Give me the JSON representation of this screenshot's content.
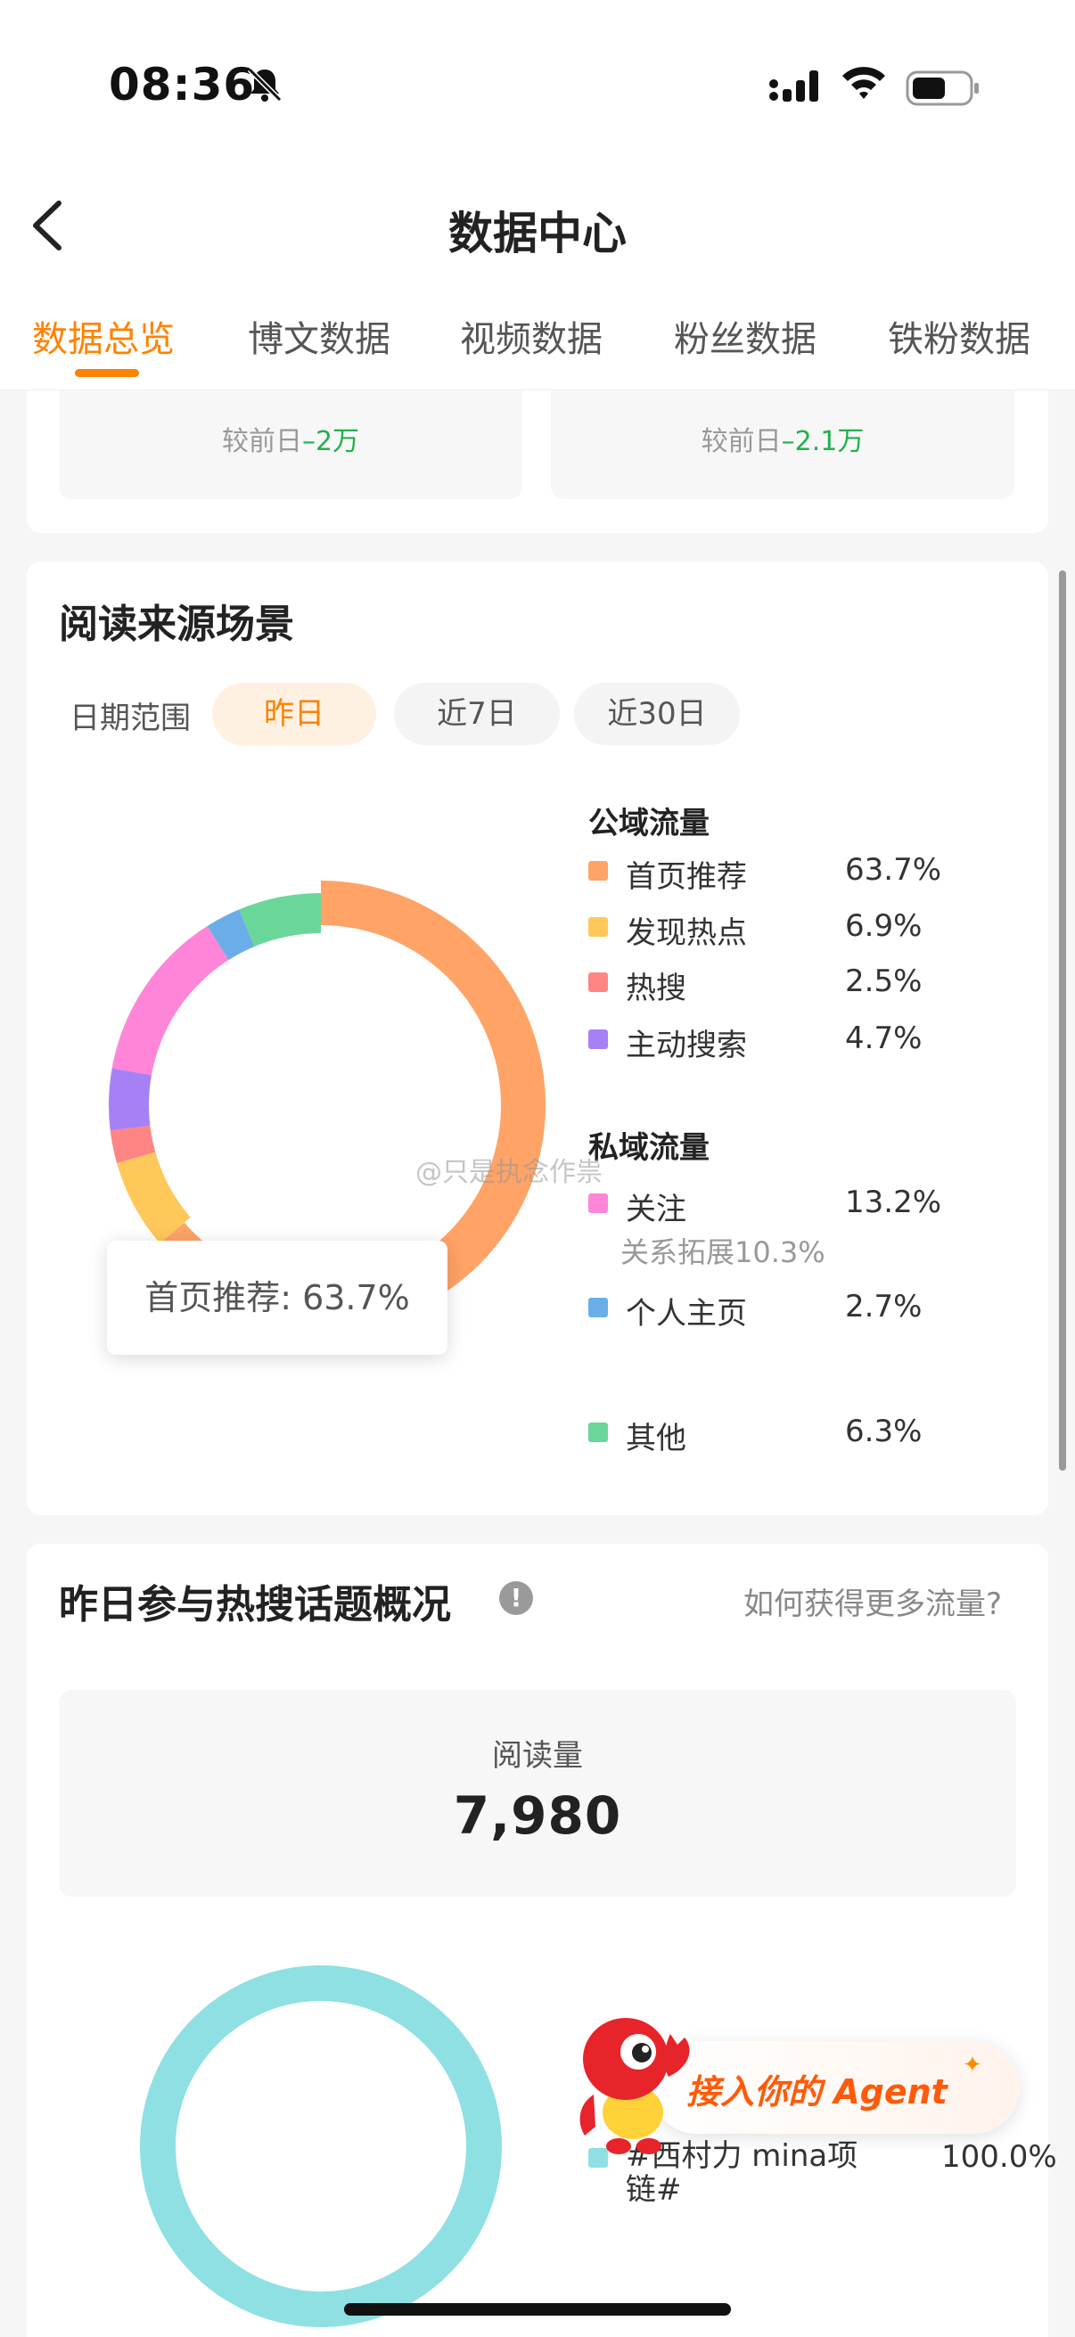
{
  "status": {
    "time": "08:36",
    "icons": [
      "bell-muted-icon",
      "signal-icon",
      "wifi-icon",
      "battery-icon"
    ]
  },
  "nav": {
    "title": "数据中心",
    "back_icon": "chevron-left-icon"
  },
  "tabs": [
    {
      "label": "数据总览",
      "active": true
    },
    {
      "label": "博文数据",
      "active": false
    },
    {
      "label": "视频数据",
      "active": false
    },
    {
      "label": "粉丝数据",
      "active": false
    },
    {
      "label": "铁粉数据",
      "active": false
    }
  ],
  "summary": [
    {
      "prefix": "较前日",
      "change": "–2万"
    },
    {
      "prefix": "较前日",
      "change": "–2.1万"
    }
  ],
  "source": {
    "title": "阅读来源场景",
    "date_label": "日期范围",
    "ranges": [
      {
        "label": "昨日",
        "active": true
      },
      {
        "label": "近7日",
        "active": false
      },
      {
        "label": "近30日",
        "active": false
      }
    ],
    "public_title": "公域流量",
    "private_title": "私域流量",
    "tooltip": "首页推荐: 63.7%",
    "follow_sub": "关系拓展10.3%"
  },
  "chart_data": {
    "type": "pie",
    "donut": true,
    "groups": [
      "公域流量",
      "私域流量"
    ],
    "categories": [
      "首页推荐",
      "发现热点",
      "热搜",
      "主动搜索",
      "关注",
      "个人主页",
      "其他"
    ],
    "labels": [
      "63.7%",
      "6.9%",
      "2.5%",
      "4.7%",
      "13.2%",
      "2.7%",
      "6.3%"
    ],
    "values": [
      63.7,
      6.9,
      2.5,
      4.7,
      13.2,
      2.7,
      6.3
    ],
    "colors": [
      "#ffa366",
      "#ffc85a",
      "#ff8585",
      "#a681f5",
      "#ff85d8",
      "#6aaee8",
      "#6bd69a"
    ],
    "sub_items": [
      {
        "parent": "关注",
        "label": "关系拓展",
        "value": "10.3%"
      }
    ]
  },
  "hot": {
    "title": "昨日参与热搜话题概况",
    "info_icon": "info-icon",
    "link": "如何获得更多流量?",
    "read_label": "阅读量",
    "read_value": "7,980",
    "topic_name": "#西村力 mina项链#",
    "topic_value": "100.0%",
    "topic_color": "#8fe0e3"
  },
  "agent": {
    "text": "接入你的 Agent"
  },
  "watermark": "@只是执念作祟"
}
